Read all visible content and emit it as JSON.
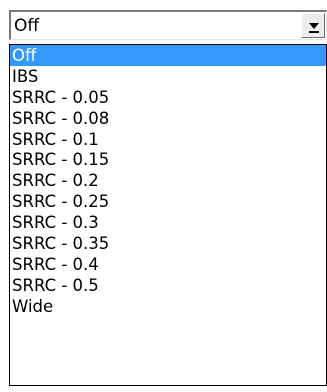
{
  "combo": {
    "value": "Off",
    "button_icon": "chevron-down-icon"
  },
  "list": {
    "selected_index": 0,
    "items": [
      "Off",
      "IBS",
      "SRRC - 0.05",
      "SRRC - 0.08",
      "SRRC - 0.1",
      "SRRC - 0.15",
      "SRRC - 0.2",
      "SRRC - 0.25",
      "SRRC - 0.3",
      "SRRC - 0.35",
      "SRRC - 0.4",
      "SRRC - 0.5",
      "Wide"
    ]
  },
  "colors": {
    "selection": "#3399ff",
    "selection_text": "#ffffff"
  }
}
